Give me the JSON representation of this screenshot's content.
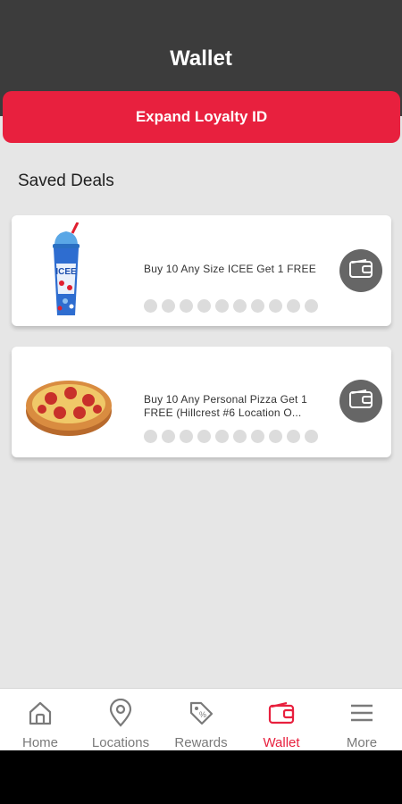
{
  "header": {
    "title": "Wallet"
  },
  "loyalty_button": {
    "label": "Expand Loyalty ID"
  },
  "saved_deals": {
    "title": "Saved Deals",
    "deals": [
      {
        "text": "Buy 10 Any Size ICEE Get 1 FREE",
        "stamps_filled": 0,
        "stamps_total": 10,
        "image": "icee-cup"
      },
      {
        "text": "Buy 10 Any Personal Pizza Get 1 FREE (Hillcrest #6 Location O...",
        "stamps_filled": 0,
        "stamps_total": 10,
        "image": "pepperoni-pizza"
      }
    ]
  },
  "tabbar": {
    "tabs": [
      {
        "label": "Home",
        "icon": "home-icon",
        "active": false
      },
      {
        "label": "Locations",
        "icon": "location-pin-icon",
        "active": false
      },
      {
        "label": "Rewards",
        "icon": "tag-icon",
        "active": false
      },
      {
        "label": "Wallet",
        "icon": "wallet-icon",
        "active": true
      },
      {
        "label": "More",
        "icon": "menu-icon",
        "active": false
      }
    ]
  },
  "colors": {
    "accent": "#e8203e",
    "header": "#3c3c3c",
    "background": "#e6e6e6"
  }
}
